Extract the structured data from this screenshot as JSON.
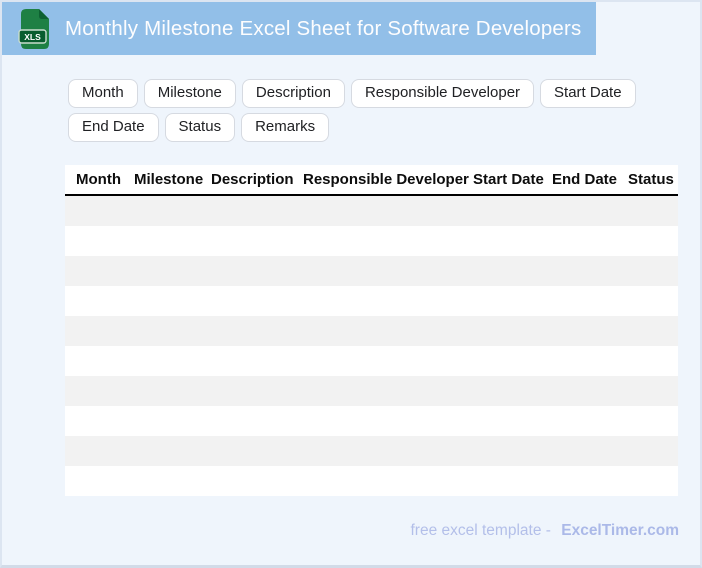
{
  "header": {
    "title": "Monthly Milestone Excel Sheet for Software Developers",
    "file_badge": "XLS"
  },
  "chips": {
    "items": [
      "Month",
      "Milestone",
      "Description",
      "Responsible Developer",
      "Start Date",
      "End Date",
      "Status",
      "Remarks"
    ]
  },
  "table": {
    "columns": [
      "Month",
      "Milestone",
      "Description",
      "Responsible Developer",
      "Start Date",
      "End Date",
      "Status"
    ],
    "empty_row_count": 10,
    "cell_values": []
  },
  "footer": {
    "caption": "free excel template -",
    "brand": "ExcelTimer.com"
  },
  "colors": {
    "header_bg": "#92bfe8",
    "page_bg": "#eff5fc",
    "row_stripe": "#f2f2f2",
    "icon_green": "#1e8044",
    "footer_text": "#b3bfe9"
  }
}
